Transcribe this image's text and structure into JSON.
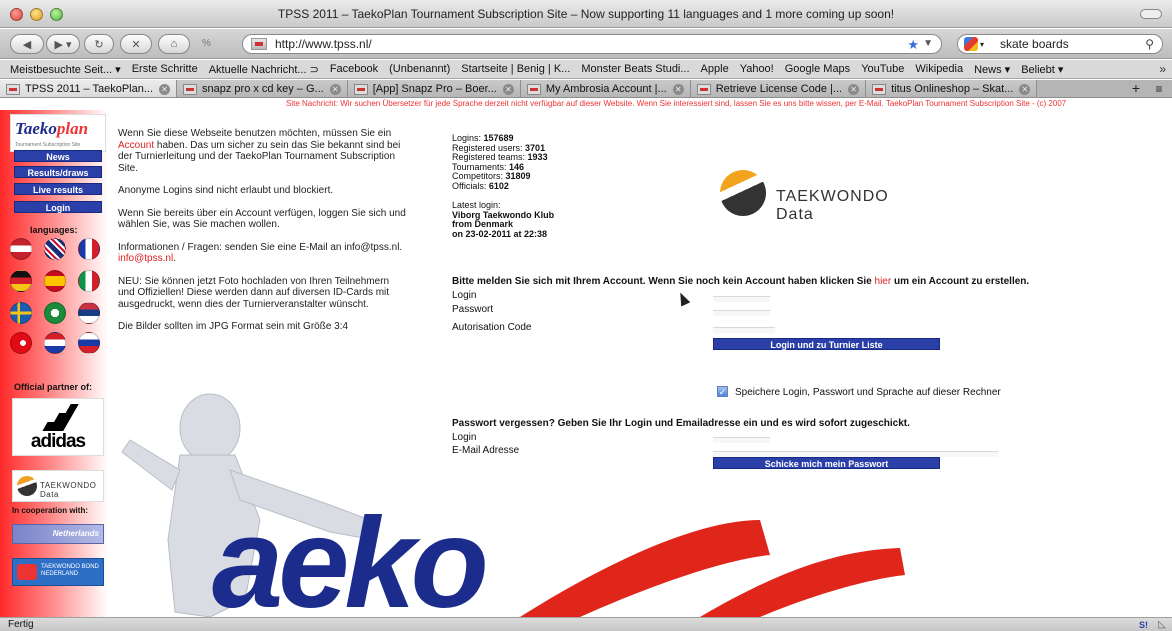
{
  "window": {
    "title": "TPSS 2011 – TaekoPlan Tournament Subscription Site – Now supporting 11 languages and 1 more coming up soon!"
  },
  "navbar": {
    "url": "http://www.tpss.nl/",
    "search_value": "skate boards"
  },
  "bookmarks": [
    "Meistbesuchte Seit... ▾",
    "Erste Schritte",
    "Aktuelle Nachricht... ⊃",
    "Facebook",
    "(Unbenannt)",
    "Startseite | Benig | K...",
    "Monster Beats Studi...",
    "Apple",
    "Yahoo!",
    "Google Maps",
    "YouTube",
    "Wikipedia",
    "News ▾",
    "Beliebt ▾"
  ],
  "tabs": [
    {
      "label": "TPSS 2011 – TaekoPlan...",
      "active": true
    },
    {
      "label": "snapz pro x cd key – G...",
      "active": false
    },
    {
      "label": "[App] Snapz Pro – Boer...",
      "active": false
    },
    {
      "label": "My Ambrosia Account |...",
      "active": false
    },
    {
      "label": "Retrieve License Code |...",
      "active": false
    },
    {
      "label": "titus Onlineshop – Skat...",
      "active": false
    }
  ],
  "ticker": "Site Nachricht: Wir suchen Übersetzer für jede Sprache derzeit nicht verfügbar auf dieser Website. Wenn Sie interessiert sind, lassen Sie es uns bitte wissen, per E-Mail. TaekoPlan Tournament Subscription Site - (c) 2007",
  "sidebar": {
    "logo_text_a": "aeko",
    "logo_text_b": "plan",
    "logo_sub": "Tournament Subscription Site",
    "menu": [
      "News",
      "Results/draws",
      "Live results",
      "Login"
    ],
    "languages_label": "languages:",
    "partner_label": "Official partner of:",
    "adidas_word": "adidas",
    "tkd_side_text": "TAEKWONDO Data",
    "coop_label": "In cooperation with:",
    "coop1_text": "Netherlands",
    "coop2_text": "TAEKWONDO BOND NEDERLAND"
  },
  "intro": {
    "p1_a": "Wenn Sie diese Webseite benutzen möchten, müssen Sie ein ",
    "p1_link": "Account",
    "p1_b": " haben. Das um sicher zu sein das Sie bekannt sind bei der Turnierleitung und der TaekoPlan Tournament Subscription Site.",
    "p2": "Anonyme Logins sind nicht erlaubt und blockiert.",
    "p3": "Wenn Sie bereits über ein Account verfügen, loggen Sie sich und wählen Sie, was Sie machen wollen.",
    "p4_a": "Informationen / Fragen: senden Sie eine E-Mail an info@tpss.nl. ",
    "p4_link": "info@tpss.nl",
    "p4_b": ".",
    "p5": "NEU: Sie können jetzt Foto hochladen von Ihren Teilnehmern und Offiziellen! Diese werden dann auf diversen ID-Cards mit ausgedruckt, wenn dies der Turnierveranstalter wünscht.",
    "p6": "Die Bilder sollten im JPG Format sein mit Größe 3:4"
  },
  "stats": [
    {
      "label": "Logins: ",
      "value": "157689"
    },
    {
      "label": "Registered users: ",
      "value": "3701"
    },
    {
      "label": "Registered teams: ",
      "value": "1933"
    },
    {
      "label": "Tournaments: ",
      "value": "146"
    },
    {
      "label": "Competitors: ",
      "value": "31809"
    },
    {
      "label": "Officials: ",
      "value": "6102"
    }
  ],
  "latest": {
    "label": "Latest login:",
    "club": "Viborg Taekwondo Klub",
    "from": "from Denmark",
    "when": "on 23-02-2011 at 22:38"
  },
  "td_logo_text": "TAEKWONDO Data",
  "login": {
    "title_a": "Bitte melden Sie sich mit Ihrem Account. Wenn Sie noch kein Account haben klicken Sie ",
    "title_link": "hier",
    "title_b": " um ein Account zu erstellen.",
    "login_label": "Login",
    "password_label": "Passwort",
    "auth_label": "Autorisation Code",
    "submit_label": "Login und zu Turnier Liste",
    "remember_label": "Speichere Login, Passwort und Sprache auf dieser Rechner"
  },
  "forgot": {
    "title": "Passwort vergessen? Geben Sie Ihr Login und Emailadresse ein und es wird sofort zugeschickt.",
    "login_label": "Login",
    "email_label": "E-Mail Adresse",
    "submit_label": "Schicke mich mein Passwort"
  },
  "art_word": "aeko",
  "status": {
    "text": "Fertig",
    "icon_text": "S!"
  }
}
